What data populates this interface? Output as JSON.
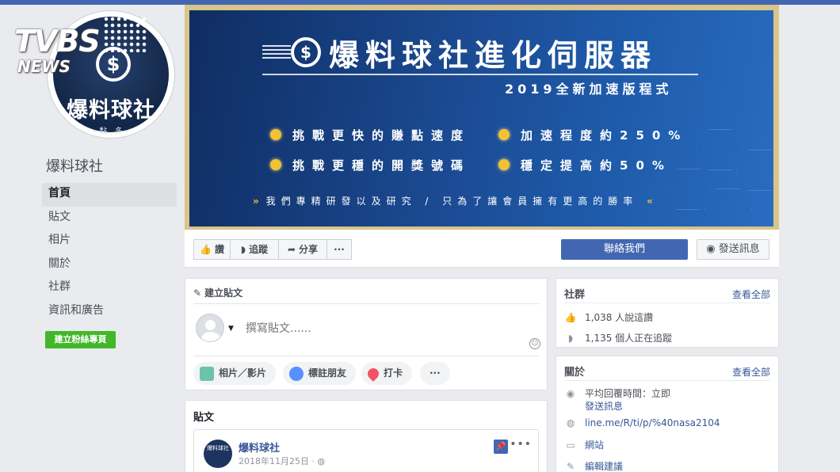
{
  "watermark": {
    "logo": "TVBS",
    "sub": "NEWS"
  },
  "page": {
    "avatar_name": "爆料球社",
    "avatar_small": "• 黏 . 多 •",
    "avatar_coin": "$",
    "name": "爆料球社"
  },
  "nav": {
    "items": [
      "首頁",
      "貼文",
      "相片",
      "關於",
      "社群",
      "資訊和廣告"
    ],
    "create_page": "建立粉絲專頁"
  },
  "cover": {
    "coin": "$",
    "title": "爆料球社進化伺服器",
    "subtitle": "2019全新加速版程式",
    "features": [
      "挑戰更快的賺點速度",
      "加速程度約250%",
      "挑戰更穩的開獎號碼",
      "穩定提高約50%"
    ],
    "tagline_chev_left": "»",
    "tagline": "我們專精研發以及研究 / 只為了讓會員擁有更高的勝率",
    "tagline_chev_right": "«",
    "colors": {
      "accent_gold": "#f1c232",
      "blue": "#1b4a92"
    }
  },
  "actionbar": {
    "like": "讚",
    "follow": "追蹤",
    "share": "分享",
    "more": "···",
    "contact": "聯絡我們",
    "message": "發送訊息"
  },
  "create_post": {
    "title": "建立貼文",
    "placeholder": "撰寫貼文......",
    "actions": [
      "相片／影片",
      "標註朋友",
      "打卡",
      "···"
    ]
  },
  "posts": {
    "title": "貼文",
    "item": {
      "author": "爆料球社",
      "date": "2018年11月25日 ·",
      "avatar_text": "爆料球社"
    }
  },
  "community": {
    "title": "社群",
    "see_all": "查看全部",
    "likes": "1,038 人說這讚",
    "follows": "1,135 個人正在追蹤"
  },
  "about": {
    "title": "關於",
    "see_all": "查看全部",
    "response": "平均回覆時間：立即",
    "send_message": "發送訊息",
    "website": "line.me/R/ti/p/%40nasa2104",
    "category": "網站",
    "suggest_edits": "編輯建議"
  }
}
